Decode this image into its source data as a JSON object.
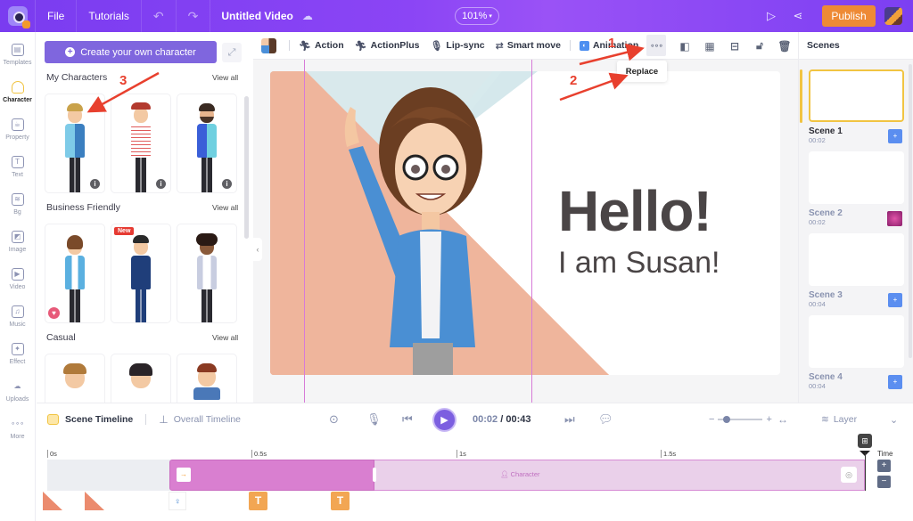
{
  "topbar": {
    "logo_icon": "animaker-camera-logo",
    "menu": [
      {
        "label": "File"
      },
      {
        "label": "Tutorials"
      }
    ],
    "undo_icon": "undo-icon",
    "redo_icon": "redo-icon",
    "title": "Untitled Video",
    "cloud_icon": "cloud-sync-icon",
    "zoom": "101%",
    "preview_icon": "play-preview-icon",
    "share_icon": "share-icon",
    "publish_label": "Publish",
    "brand_color": "#8344f4",
    "publish_color": "#ee8a35"
  },
  "leftnav": {
    "items": [
      {
        "label": "Templates",
        "icon": "templates-icon",
        "glyph": "▤"
      },
      {
        "label": "Character",
        "icon": "character-icon",
        "glyph": "",
        "active": true
      },
      {
        "label": "Property",
        "icon": "property-icon",
        "glyph": "☕"
      },
      {
        "label": "Text",
        "icon": "text-icon",
        "glyph": "T"
      },
      {
        "label": "Bg",
        "icon": "background-icon",
        "glyph": "≋"
      },
      {
        "label": "Image",
        "icon": "image-icon",
        "glyph": "◩"
      },
      {
        "label": "Video",
        "icon": "video-icon",
        "glyph": "▶"
      },
      {
        "label": "Music",
        "icon": "music-icon",
        "glyph": "♫"
      },
      {
        "label": "Effect",
        "icon": "effect-icon",
        "glyph": "✦"
      },
      {
        "label": "Uploads",
        "icon": "uploads-icon",
        "glyph": "☁"
      },
      {
        "label": "More",
        "icon": "more-icon",
        "glyph": "∘∘∘"
      }
    ]
  },
  "panel": {
    "create_label": "Create your own character",
    "sections": [
      {
        "title": "My Characters",
        "view_all": "View all"
      },
      {
        "title": "Business Friendly",
        "view_all": "View all",
        "new_badge": "New"
      },
      {
        "title": "Casual",
        "view_all": "View all"
      }
    ]
  },
  "toolbar": {
    "buttons": [
      {
        "label": "Action",
        "icon": "action-run-icon"
      },
      {
        "label": "ActionPlus",
        "icon": "actionplus-run-icon"
      },
      {
        "label": "Lip-sync",
        "icon": "microphone-icon"
      },
      {
        "label": "Smart move",
        "icon": "smart-move-icon"
      },
      {
        "label": "Animation",
        "icon": "animation-icon"
      }
    ],
    "more_tooltip": "Replace"
  },
  "canvas": {
    "heading": "Hello!",
    "subheading": "I am Susan!"
  },
  "annotations": [
    {
      "label": "1"
    },
    {
      "label": "2"
    },
    {
      "label": "3"
    }
  ],
  "scenes": {
    "title": "Scenes",
    "items": [
      {
        "name": "Scene 1",
        "duration": "00:02",
        "active": true
      },
      {
        "name": "Scene 2",
        "duration": "00:02"
      },
      {
        "name": "Scene 3",
        "duration": "00:04"
      },
      {
        "name": "Scene 4",
        "duration": "00:04"
      }
    ]
  },
  "timeline": {
    "tabs": [
      {
        "label": "Scene Timeline",
        "active": true
      },
      {
        "label": "Overall Timeline"
      }
    ],
    "current_time": "00:02",
    "separator": "/",
    "total_time": "00:43",
    "layer_label": "Layer",
    "ticks": [
      "0s",
      "0.5s",
      "1s",
      "1.5s"
    ],
    "time_label": "Time",
    "track_label": "Character",
    "text_element": "T"
  }
}
